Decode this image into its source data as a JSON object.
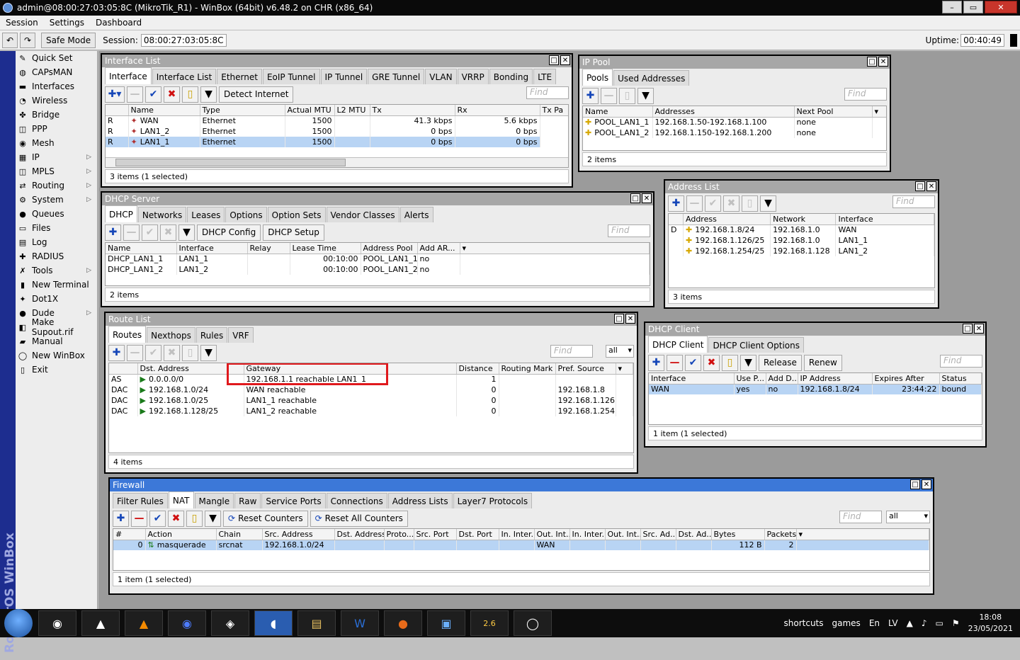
{
  "app": {
    "title": "admin@08:00:27:03:05:8C (MikroTik_R1) - WinBox (64bit) v6.48.2 on CHR (x86_64)",
    "brand": "RouterOS WinBox"
  },
  "menu": [
    "Session",
    "Settings",
    "Dashboard"
  ],
  "toolbar": {
    "safe_mode": "Safe Mode",
    "session_label": "Session:",
    "session_value": "08:00:27:03:05:8C",
    "uptime_label": "Uptime:",
    "uptime_value": "00:40:49"
  },
  "sidebar": [
    {
      "label": "Quick Set",
      "icon": "wand-icon",
      "glyph": "✎",
      "arrow": false
    },
    {
      "label": "CAPsMAN",
      "icon": "capsman-icon",
      "glyph": "◍",
      "arrow": false
    },
    {
      "label": "Interfaces",
      "icon": "interfaces-icon",
      "glyph": "▬",
      "arrow": false
    },
    {
      "label": "Wireless",
      "icon": "wireless-icon",
      "glyph": "◔",
      "arrow": false
    },
    {
      "label": "Bridge",
      "icon": "bridge-icon",
      "glyph": "✤",
      "arrow": false
    },
    {
      "label": "PPP",
      "icon": "ppp-icon",
      "glyph": "◫",
      "arrow": false
    },
    {
      "label": "Mesh",
      "icon": "mesh-icon",
      "glyph": "◉",
      "arrow": false
    },
    {
      "label": "IP",
      "icon": "ip-icon",
      "glyph": "▦",
      "arrow": true
    },
    {
      "label": "MPLS",
      "icon": "mpls-icon",
      "glyph": "◫",
      "arrow": true
    },
    {
      "label": "Routing",
      "icon": "routing-icon",
      "glyph": "⇄",
      "arrow": true
    },
    {
      "label": "System",
      "icon": "system-icon",
      "glyph": "⚙",
      "arrow": true
    },
    {
      "label": "Queues",
      "icon": "queues-icon",
      "glyph": "●",
      "arrow": false
    },
    {
      "label": "Files",
      "icon": "files-icon",
      "glyph": "▭",
      "arrow": false
    },
    {
      "label": "Log",
      "icon": "log-icon",
      "glyph": "▤",
      "arrow": false
    },
    {
      "label": "RADIUS",
      "icon": "radius-icon",
      "glyph": "✚",
      "arrow": false
    },
    {
      "label": "Tools",
      "icon": "tools-icon",
      "glyph": "✗",
      "arrow": true
    },
    {
      "label": "New Terminal",
      "icon": "terminal-icon",
      "glyph": "▮",
      "arrow": false
    },
    {
      "label": "Dot1X",
      "icon": "dot1x-icon",
      "glyph": "✦",
      "arrow": false
    },
    {
      "label": "Dude",
      "icon": "dude-icon",
      "glyph": "●",
      "arrow": true
    },
    {
      "label": "Make Supout.rif",
      "icon": "supout-icon",
      "glyph": "◧",
      "arrow": false
    },
    {
      "label": "Manual",
      "icon": "manual-icon",
      "glyph": "▰",
      "arrow": false
    },
    {
      "label": "New WinBox",
      "icon": "winbox-icon",
      "glyph": "◯",
      "arrow": false
    },
    {
      "label": "Exit",
      "icon": "exit-icon",
      "glyph": "▯",
      "arrow": false
    }
  ],
  "iface": {
    "title": "Interface List",
    "tabs": [
      "Interface",
      "Interface List",
      "Ethernet",
      "EoIP Tunnel",
      "IP Tunnel",
      "GRE Tunnel",
      "VLAN",
      "VRRP",
      "Bonding",
      "LTE"
    ],
    "detect": "Detect Internet",
    "find": "Find",
    "cols": [
      "",
      "Name",
      "Type",
      "Actual MTU",
      "L2 MTU",
      "Tx",
      "Rx",
      "Tx Pa"
    ],
    "rows": [
      [
        "R",
        "WAN",
        "Ethernet",
        "1500",
        "",
        "41.3 kbps",
        "5.6 kbps"
      ],
      [
        "R",
        "LAN1_2",
        "Ethernet",
        "1500",
        "",
        "0 bps",
        "0 bps"
      ],
      [
        "R",
        "LAN1_1",
        "Ethernet",
        "1500",
        "",
        "0 bps",
        "0 bps"
      ]
    ],
    "status": "3 items (1 selected)"
  },
  "pool": {
    "title": "IP Pool",
    "tabs": [
      "Pools",
      "Used Addresses"
    ],
    "find": "Find",
    "cols": [
      "Name",
      "Addresses",
      "Next Pool"
    ],
    "rows": [
      [
        "POOL_LAN1_1",
        "192.168.1.50-192.168.1.100",
        "none"
      ],
      [
        "POOL_LAN1_2",
        "192.168.1.150-192.168.1.200",
        "none"
      ]
    ],
    "status": "2 items"
  },
  "dhcps": {
    "title": "DHCP Server",
    "tabs": [
      "DHCP",
      "Networks",
      "Leases",
      "Options",
      "Option Sets",
      "Vendor Classes",
      "Alerts"
    ],
    "btn_config": "DHCP Config",
    "btn_setup": "DHCP Setup",
    "find": "Find",
    "cols": [
      "Name",
      "Interface",
      "Relay",
      "Lease Time",
      "Address Pool",
      "Add AR..."
    ],
    "rows": [
      [
        "DHCP_LAN1_1",
        "LAN1_1",
        "",
        "00:10:00",
        "POOL_LAN1_1",
        "no"
      ],
      [
        "DHCP_LAN1_2",
        "LAN1_2",
        "",
        "00:10:00",
        "POOL_LAN1_2",
        "no"
      ]
    ],
    "status": "2 items"
  },
  "addr": {
    "title": "Address List",
    "find": "Find",
    "cols": [
      "",
      "Address",
      "Network",
      "Interface"
    ],
    "rows": [
      [
        "D",
        "192.168.1.8/24",
        "192.168.1.0",
        "WAN"
      ],
      [
        "",
        "192.168.1.126/25",
        "192.168.1.0",
        "LAN1_1"
      ],
      [
        "",
        "192.168.1.254/25",
        "192.168.1.128",
        "LAN1_2"
      ]
    ],
    "status": "3 items"
  },
  "route": {
    "title": "Route List",
    "tabs": [
      "Routes",
      "Nexthops",
      "Rules",
      "VRF"
    ],
    "find": "Find",
    "filter": "all",
    "cols": [
      "",
      "Dst. Address",
      "Gateway",
      "Distance",
      "Routing Mark",
      "Pref. Source"
    ],
    "rows": [
      [
        "AS",
        "0.0.0.0/0",
        "192.168.1.1 reachable LAN1_1",
        "1",
        "",
        ""
      ],
      [
        "DAC",
        "192.168.1.0/24",
        "WAN reachable",
        "0",
        "",
        "192.168.1.8"
      ],
      [
        "DAC",
        "192.168.1.0/25",
        "LAN1_1 reachable",
        "0",
        "",
        "192.168.1.126"
      ],
      [
        "DAC",
        "192.168.1.128/25",
        "LAN1_2 reachable",
        "0",
        "",
        "192.168.1.254"
      ]
    ],
    "status": "4 items"
  },
  "dhcpc": {
    "title": "DHCP Client",
    "tabs": [
      "DHCP Client",
      "DHCP Client Options"
    ],
    "release": "Release",
    "renew": "Renew",
    "find": "Find",
    "cols": [
      "Interface",
      "Use P...",
      "Add D...",
      "IP Address",
      "Expires After",
      "Status"
    ],
    "rows": [
      [
        "WAN",
        "yes",
        "no",
        "192.168.1.8/24",
        "23:44:22",
        "bound"
      ]
    ],
    "status": "1 item (1 selected)"
  },
  "fw": {
    "title": "Firewall",
    "tabs": [
      "Filter Rules",
      "NAT",
      "Mangle",
      "Raw",
      "Service Ports",
      "Connections",
      "Address Lists",
      "Layer7 Protocols"
    ],
    "reset": "Reset Counters",
    "reset_all": "Reset All Counters",
    "find": "Find",
    "filter": "all",
    "cols": [
      "#",
      "Action",
      "Chain",
      "Src. Address",
      "Dst. Address",
      "Proto...",
      "Src. Port",
      "Dst. Port",
      "In. Inter...",
      "Out. Int...",
      "In. Inter...",
      "Out. Int...",
      "Src. Ad...",
      "Dst. Ad...",
      "Bytes",
      "Packets"
    ],
    "rows": [
      [
        "0",
        "masquerade",
        "srcnat",
        "192.168.1.0/24",
        "",
        "",
        "",
        "",
        "",
        "WAN",
        "",
        "",
        "",
        "",
        "112 B",
        "2"
      ]
    ],
    "status": "1 item (1 selected)"
  },
  "taskbar": {
    "shortcuts": "shortcuts",
    "games": "games",
    "lang": "En",
    "kb": "LV",
    "time": "18:08",
    "date": "23/05/2021",
    "badge": "2.6"
  }
}
